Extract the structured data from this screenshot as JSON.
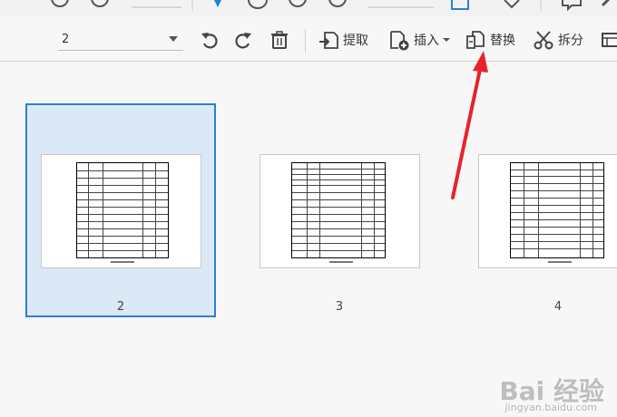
{
  "toolbar": {
    "page_value": "2",
    "extract_label": "提取",
    "insert_label": "插入",
    "replace_label": "替换",
    "split_label": "拆分"
  },
  "thumbnails": [
    {
      "page": "2",
      "selected": true
    },
    {
      "page": "3",
      "selected": false
    },
    {
      "page": "4",
      "selected": false
    }
  ],
  "colors": {
    "selection_border": "#2b7fd6",
    "selection_fill": "#dbe9f7",
    "arrow": "#e8232b"
  },
  "watermark": {
    "logo": "Bai 经验",
    "url": "jingyan.baidu.com"
  }
}
